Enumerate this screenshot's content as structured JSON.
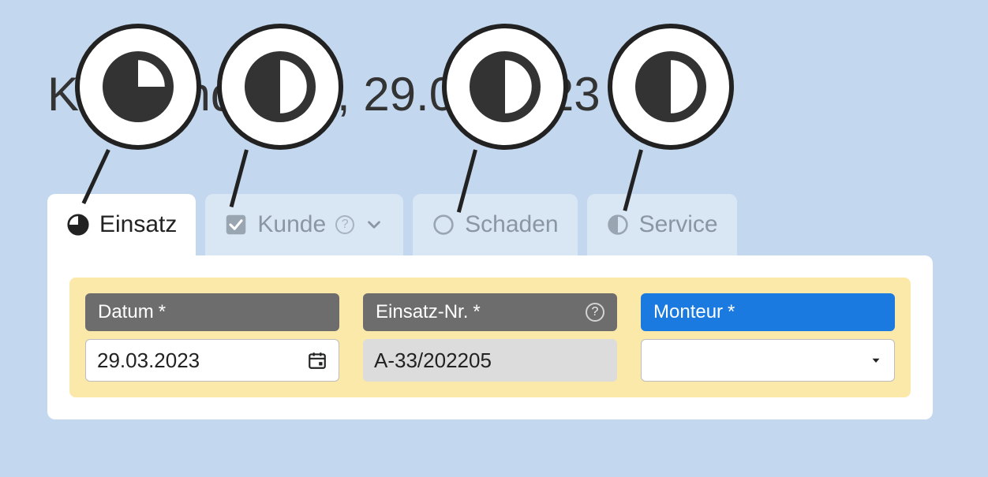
{
  "title": "Kundendienst, 29.03.2023",
  "tabs": [
    {
      "label": "Einsatz",
      "icon": "pie-75",
      "active": true
    },
    {
      "label": "Kunde",
      "icon": "checkbox",
      "active": false,
      "has_help": true,
      "has_chevron": true
    },
    {
      "label": "Schaden",
      "icon": "circle-empty",
      "active": false
    },
    {
      "label": "Service",
      "icon": "half-circle",
      "active": false
    }
  ],
  "fields": {
    "datum": {
      "label": "Datum",
      "required": true,
      "value": "29.03.2023"
    },
    "einsatznr": {
      "label": "Einsatz-Nr.",
      "required": true,
      "value": "A-33/202205",
      "has_help": true
    },
    "monteur": {
      "label": "Monteur",
      "required": true,
      "value": ""
    }
  },
  "callouts": [
    {
      "target_tab": 0
    },
    {
      "target_tab": 1
    },
    {
      "target_tab": 2
    },
    {
      "target_tab": 3
    }
  ]
}
